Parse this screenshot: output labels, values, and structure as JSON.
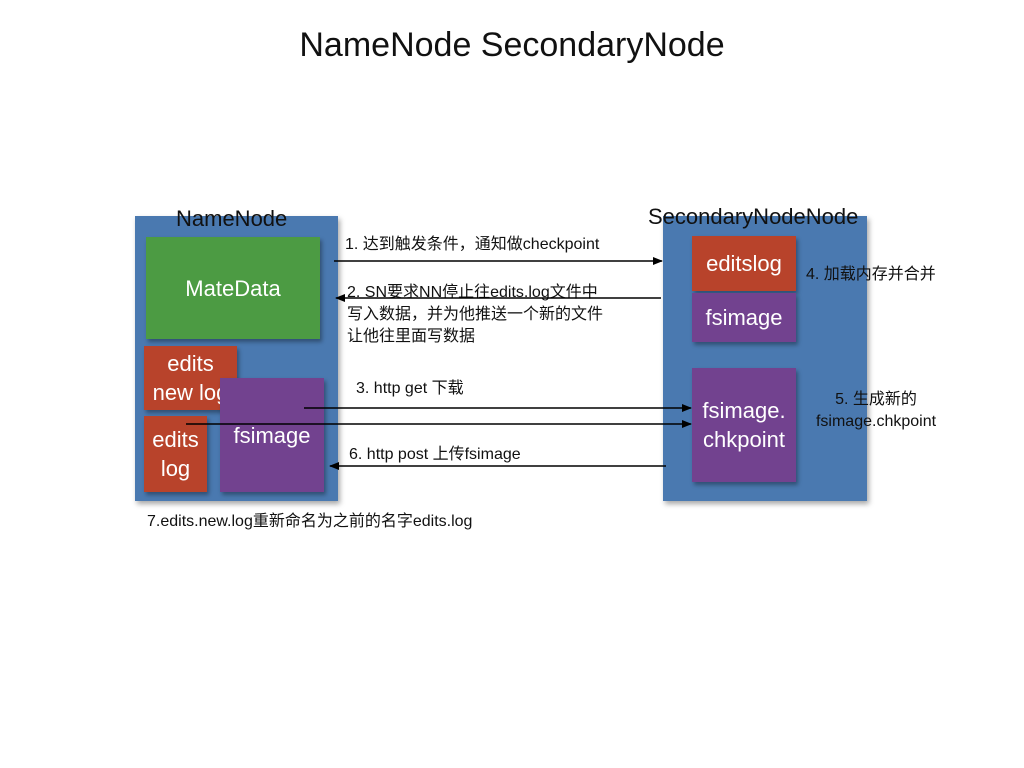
{
  "title": "NameNode SecondaryNode",
  "namenode": {
    "label": "NameNode",
    "metadata": "MateData",
    "edits_new_log": "edits\nnew log",
    "edits_log": "edits\nlog",
    "fsimage": "fsimage"
  },
  "secondary": {
    "label": "SecondaryNodeNode",
    "editslog": "editslog",
    "fsimage": "fsimage",
    "fsimage_chkpoint": "fsimage.\nchkpoint"
  },
  "steps": {
    "step1": "1. 达到触发条件，通知做checkpoint",
    "step2": "2. SN要求NN停止往edits.log文件中\n写入数据，并为他推送一个新的文件\n让他往里面写数据",
    "step3": "3. http  get 下载",
    "step4": "4. 加载内存并合并",
    "step5": "5. 生成新的\nfsimage.chkpoint",
    "step6": "6. http  post 上传fsimage",
    "step7": "7.edits.new.log重新命名为之前的名字edits.log"
  },
  "colors": {
    "panel": "#4a79b0",
    "metadata": "#4c9b43",
    "edits": "#b8432b",
    "fsimage": "#72428f"
  }
}
